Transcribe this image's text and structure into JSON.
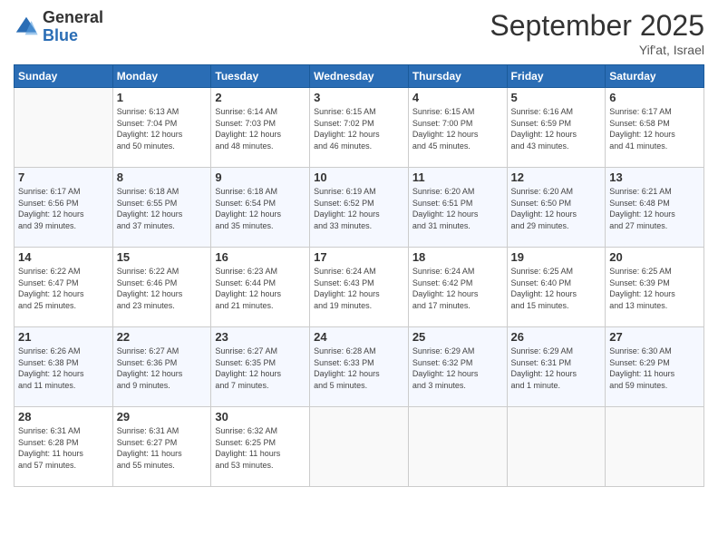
{
  "logo": {
    "general": "General",
    "blue": "Blue"
  },
  "header": {
    "month": "September 2025",
    "location": "Yif'at, Israel"
  },
  "days_header": [
    "Sunday",
    "Monday",
    "Tuesday",
    "Wednesday",
    "Thursday",
    "Friday",
    "Saturday"
  ],
  "weeks": [
    [
      {
        "num": "",
        "info": ""
      },
      {
        "num": "1",
        "info": "Sunrise: 6:13 AM\nSunset: 7:04 PM\nDaylight: 12 hours\nand 50 minutes."
      },
      {
        "num": "2",
        "info": "Sunrise: 6:14 AM\nSunset: 7:03 PM\nDaylight: 12 hours\nand 48 minutes."
      },
      {
        "num": "3",
        "info": "Sunrise: 6:15 AM\nSunset: 7:02 PM\nDaylight: 12 hours\nand 46 minutes."
      },
      {
        "num": "4",
        "info": "Sunrise: 6:15 AM\nSunset: 7:00 PM\nDaylight: 12 hours\nand 45 minutes."
      },
      {
        "num": "5",
        "info": "Sunrise: 6:16 AM\nSunset: 6:59 PM\nDaylight: 12 hours\nand 43 minutes."
      },
      {
        "num": "6",
        "info": "Sunrise: 6:17 AM\nSunset: 6:58 PM\nDaylight: 12 hours\nand 41 minutes."
      }
    ],
    [
      {
        "num": "7",
        "info": "Sunrise: 6:17 AM\nSunset: 6:56 PM\nDaylight: 12 hours\nand 39 minutes."
      },
      {
        "num": "8",
        "info": "Sunrise: 6:18 AM\nSunset: 6:55 PM\nDaylight: 12 hours\nand 37 minutes."
      },
      {
        "num": "9",
        "info": "Sunrise: 6:18 AM\nSunset: 6:54 PM\nDaylight: 12 hours\nand 35 minutes."
      },
      {
        "num": "10",
        "info": "Sunrise: 6:19 AM\nSunset: 6:52 PM\nDaylight: 12 hours\nand 33 minutes."
      },
      {
        "num": "11",
        "info": "Sunrise: 6:20 AM\nSunset: 6:51 PM\nDaylight: 12 hours\nand 31 minutes."
      },
      {
        "num": "12",
        "info": "Sunrise: 6:20 AM\nSunset: 6:50 PM\nDaylight: 12 hours\nand 29 minutes."
      },
      {
        "num": "13",
        "info": "Sunrise: 6:21 AM\nSunset: 6:48 PM\nDaylight: 12 hours\nand 27 minutes."
      }
    ],
    [
      {
        "num": "14",
        "info": "Sunrise: 6:22 AM\nSunset: 6:47 PM\nDaylight: 12 hours\nand 25 minutes."
      },
      {
        "num": "15",
        "info": "Sunrise: 6:22 AM\nSunset: 6:46 PM\nDaylight: 12 hours\nand 23 minutes."
      },
      {
        "num": "16",
        "info": "Sunrise: 6:23 AM\nSunset: 6:44 PM\nDaylight: 12 hours\nand 21 minutes."
      },
      {
        "num": "17",
        "info": "Sunrise: 6:24 AM\nSunset: 6:43 PM\nDaylight: 12 hours\nand 19 minutes."
      },
      {
        "num": "18",
        "info": "Sunrise: 6:24 AM\nSunset: 6:42 PM\nDaylight: 12 hours\nand 17 minutes."
      },
      {
        "num": "19",
        "info": "Sunrise: 6:25 AM\nSunset: 6:40 PM\nDaylight: 12 hours\nand 15 minutes."
      },
      {
        "num": "20",
        "info": "Sunrise: 6:25 AM\nSunset: 6:39 PM\nDaylight: 12 hours\nand 13 minutes."
      }
    ],
    [
      {
        "num": "21",
        "info": "Sunrise: 6:26 AM\nSunset: 6:38 PM\nDaylight: 12 hours\nand 11 minutes."
      },
      {
        "num": "22",
        "info": "Sunrise: 6:27 AM\nSunset: 6:36 PM\nDaylight: 12 hours\nand 9 minutes."
      },
      {
        "num": "23",
        "info": "Sunrise: 6:27 AM\nSunset: 6:35 PM\nDaylight: 12 hours\nand 7 minutes."
      },
      {
        "num": "24",
        "info": "Sunrise: 6:28 AM\nSunset: 6:33 PM\nDaylight: 12 hours\nand 5 minutes."
      },
      {
        "num": "25",
        "info": "Sunrise: 6:29 AM\nSunset: 6:32 PM\nDaylight: 12 hours\nand 3 minutes."
      },
      {
        "num": "26",
        "info": "Sunrise: 6:29 AM\nSunset: 6:31 PM\nDaylight: 12 hours\nand 1 minute."
      },
      {
        "num": "27",
        "info": "Sunrise: 6:30 AM\nSunset: 6:29 PM\nDaylight: 11 hours\nand 59 minutes."
      }
    ],
    [
      {
        "num": "28",
        "info": "Sunrise: 6:31 AM\nSunset: 6:28 PM\nDaylight: 11 hours\nand 57 minutes."
      },
      {
        "num": "29",
        "info": "Sunrise: 6:31 AM\nSunset: 6:27 PM\nDaylight: 11 hours\nand 55 minutes."
      },
      {
        "num": "30",
        "info": "Sunrise: 6:32 AM\nSunset: 6:25 PM\nDaylight: 11 hours\nand 53 minutes."
      },
      {
        "num": "",
        "info": ""
      },
      {
        "num": "",
        "info": ""
      },
      {
        "num": "",
        "info": ""
      },
      {
        "num": "",
        "info": ""
      }
    ]
  ]
}
